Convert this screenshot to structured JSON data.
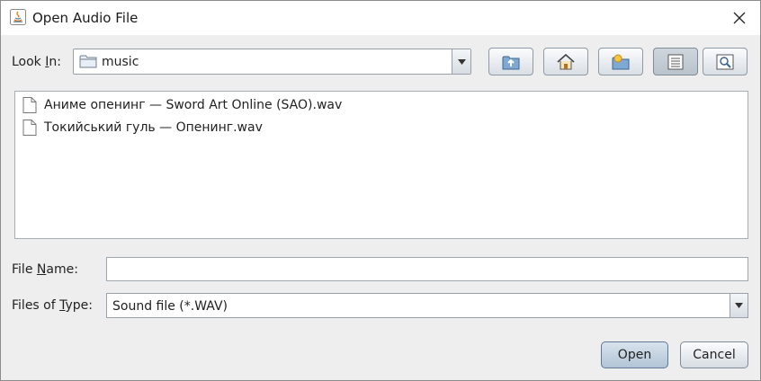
{
  "window": {
    "title": "Open Audio File"
  },
  "look_in": {
    "label_pre": "Look ",
    "label_mnemonic": "I",
    "label_post": "n:",
    "value": "music"
  },
  "toolbar": {
    "icons": [
      "up-folder-icon",
      "home-icon",
      "new-folder-icon",
      "list-view-icon",
      "details-view-icon"
    ]
  },
  "files": [
    {
      "name": "Аниме опенинг — Sword Art Online (SAO).wav",
      "icon": "file-icon"
    },
    {
      "name": "Токийський гуль — Опенинг.wav",
      "icon": "file-icon"
    }
  ],
  "file_name": {
    "label_pre": "File ",
    "label_mnemonic": "N",
    "label_post": "ame:",
    "value": ""
  },
  "file_type": {
    "label_pre": "Files of ",
    "label_mnemonic": "T",
    "label_post": "ype:",
    "value": "Sound file (*.WAV)"
  },
  "buttons": {
    "open": "Open",
    "cancel": "Cancel"
  },
  "colors": {
    "dialog_bg": "#eeeeee",
    "default_button": "#b2c4d6"
  }
}
